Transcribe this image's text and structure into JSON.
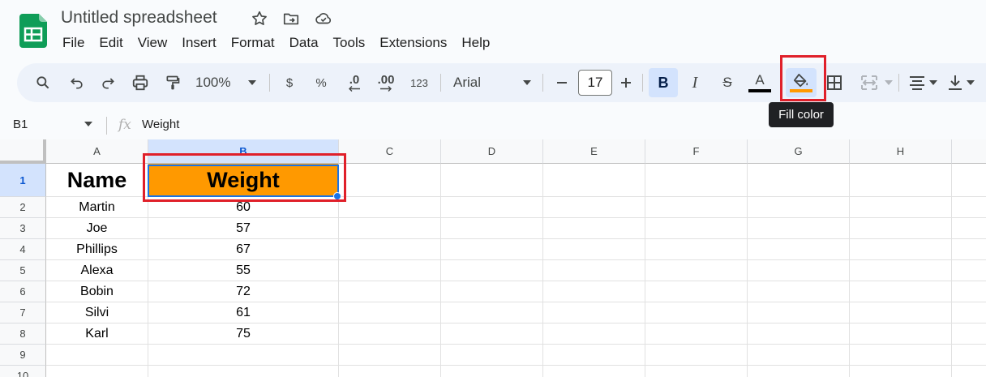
{
  "app": {
    "title": "Untitled spreadsheet",
    "brand_color": "#0f9d58"
  },
  "menu": [
    "File",
    "Edit",
    "View",
    "Insert",
    "Format",
    "Data",
    "Tools",
    "Extensions",
    "Help"
  ],
  "toolbar": {
    "zoom": "100%",
    "currency": "$",
    "percent": "%",
    "dec_decrease": ".0",
    "dec_increase": ".00",
    "number_format": "123",
    "font": "Arial",
    "font_size": "17",
    "bold": "B",
    "italic": "I",
    "strike": "S",
    "text_color": "A",
    "text_color_swatch": "#000000",
    "fill_color_swatch": "#ff9900",
    "fill_tooltip": "Fill color"
  },
  "formula_bar": {
    "name_box": "B1",
    "fx": "fx",
    "content": "Weight"
  },
  "sheet": {
    "columns": [
      "A",
      "B",
      "C",
      "D",
      "E",
      "F",
      "G",
      "H"
    ],
    "rows": [
      "1",
      "2",
      "3",
      "4",
      "5",
      "6",
      "7",
      "8",
      "9",
      "10"
    ],
    "selected_cell": "B1",
    "fill_color": "#ff9900",
    "highlight_color": "#e0202a",
    "data": [
      [
        "Name",
        "Weight"
      ],
      [
        "Martin",
        "60"
      ],
      [
        "Joe",
        "57"
      ],
      [
        "Phillips",
        "67"
      ],
      [
        "Alexa",
        "55"
      ],
      [
        "Bobin",
        "72"
      ],
      [
        "Silvi",
        "61"
      ],
      [
        "Karl",
        "75"
      ]
    ]
  }
}
